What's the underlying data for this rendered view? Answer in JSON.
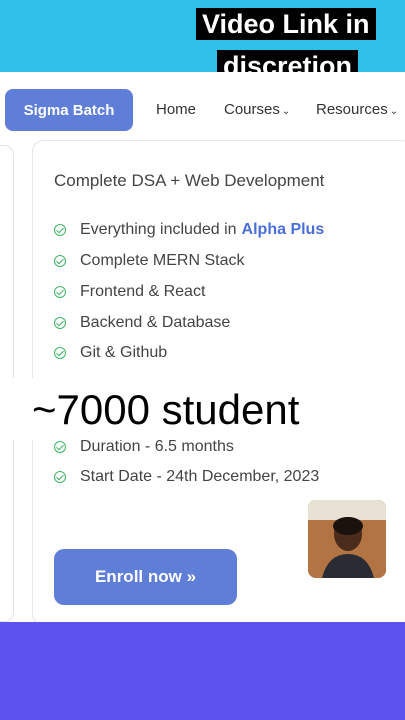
{
  "caption": {
    "line1": "Video Link in",
    "line2": "discretion"
  },
  "nav": {
    "brand": "Sigma Batch",
    "links": [
      {
        "label": "Home",
        "chevron": ""
      },
      {
        "label": "Courses",
        "chevron": "⌄"
      },
      {
        "label": "Resources",
        "chevron": "⌄"
      }
    ]
  },
  "card": {
    "title": "Complete DSA + Web Development",
    "features": [
      {
        "text": "Everything included in",
        "highlight": "Alpha Plus"
      },
      {
        "text": "Complete MERN Stack"
      },
      {
        "text": "Frontend & React"
      },
      {
        "text": "Backend & Database"
      },
      {
        "text": "Git & Github"
      },
      {
        "text": "Duration - 6.5 months"
      },
      {
        "text": "Start Date - 24th December, 2023"
      }
    ],
    "enroll_label": "Enroll now »"
  },
  "overlay_text": "~7000 student",
  "colors": {
    "top_band": "#2fbfe9",
    "bottom_band": "#5b52f0",
    "button": "#5f7ed8",
    "check": "#3fb463"
  }
}
